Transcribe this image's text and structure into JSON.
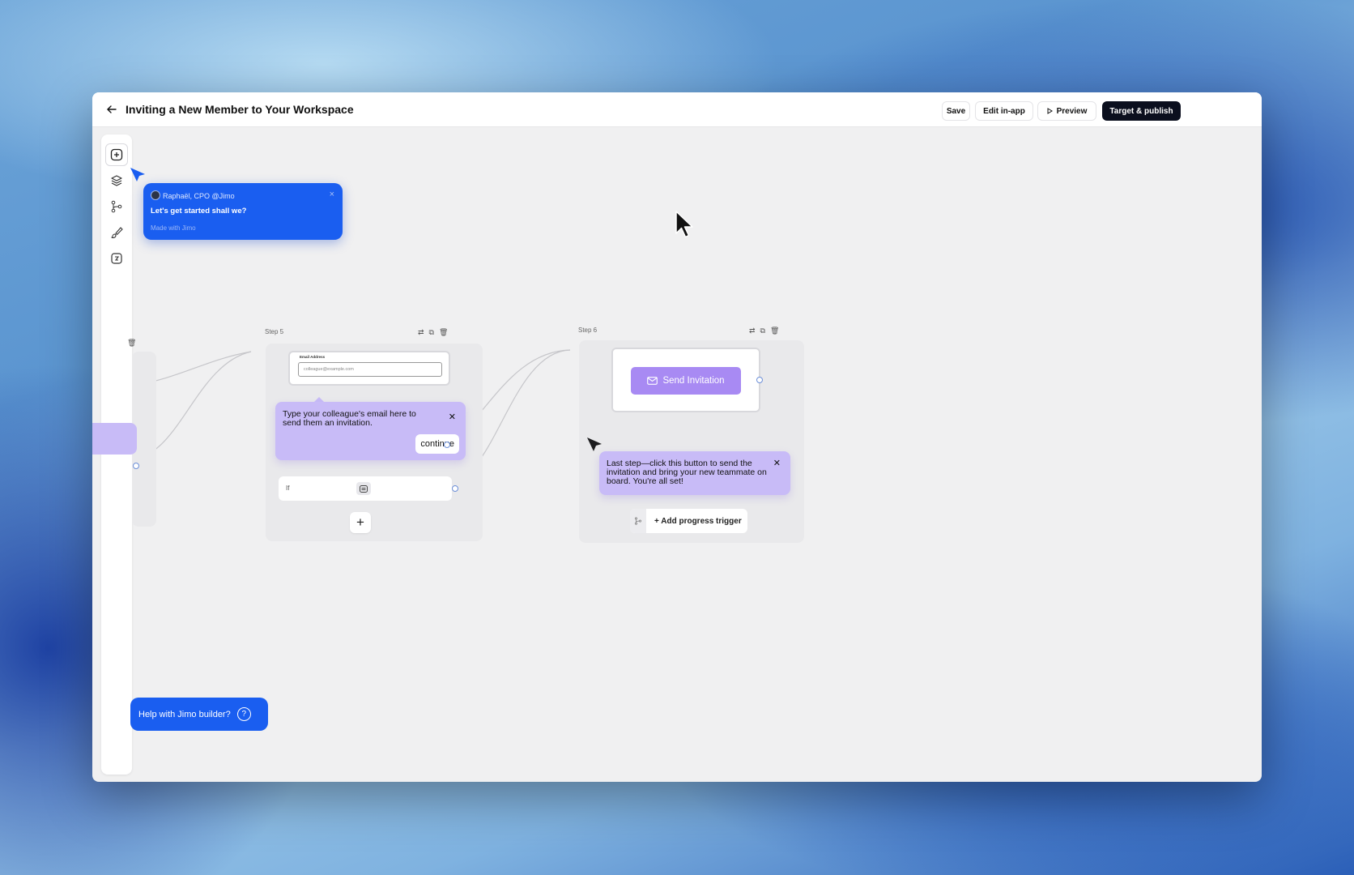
{
  "header": {
    "title": "Inviting a New Member to Your Workspace",
    "back_icon": "arrow-left-icon",
    "buttons": {
      "save": "Save",
      "edit_in_app": "Edit in-app",
      "preview": "Preview",
      "target_publish": "Target & publish"
    }
  },
  "sidebar": {
    "items": [
      {
        "icon": "add-icon"
      },
      {
        "icon": "layers-icon"
      },
      {
        "icon": "branch-icon"
      },
      {
        "icon": "brush-icon"
      },
      {
        "icon": "variable-icon"
      }
    ]
  },
  "bubble": {
    "author": "Raphaël, CPO @Jimo",
    "message": "Let's get started shall we?",
    "made_with": "Made with Jimo",
    "close": "×"
  },
  "step5": {
    "label": "Step 5",
    "email_label": "Email Address",
    "email_placeholder": "colleague@example.com",
    "tooltip_text": "Type your colleague's email here to send them an invitation.",
    "continue_label": "continue",
    "if_label": "If",
    "add_label": "+"
  },
  "step6": {
    "label": "Step 6",
    "send_button": "Send Invitation",
    "tooltip_text": "Last step—click this button to send the invitation and bring your new teammate on board. You're all set!",
    "trigger_label": "+ Add progress trigger"
  },
  "help": {
    "label": "Help with Jimo builder?",
    "icon": "?"
  },
  "colors": {
    "accent_blue": "#1a5ef0",
    "tooltip_purple": "#c8bbf7",
    "button_purple": "#a88af3",
    "primary_dark": "#0b0f1e"
  }
}
